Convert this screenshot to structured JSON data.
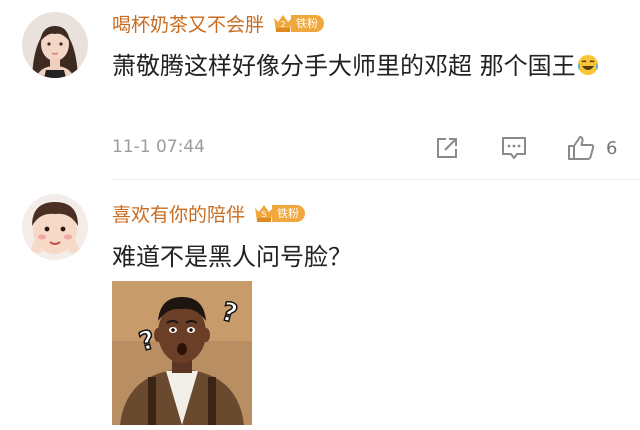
{
  "comments": [
    {
      "username": "喝杯奶茶又不会胖",
      "fan_badge": {
        "level": "2",
        "label": "铁粉"
      },
      "text": "萧敬腾这样好像分手大师里的邓超 那个国王",
      "emoji": "laugh-cry-emoji",
      "timestamp": "11-1 07:44",
      "likes": "6",
      "icons": [
        "share-icon",
        "comment-icon",
        "like-icon"
      ]
    },
    {
      "username": "喜欢有你的陪伴",
      "fan_badge": {
        "level": "5",
        "label": "铁粉"
      },
      "text": "难道不是黑人问号脸？",
      "image": "black-man-question-mark-meme",
      "image_text": [
        "?",
        "?"
      ]
    }
  ],
  "colors": {
    "username": "#c96c21",
    "badge": "#f0a73c",
    "meta": "#9b9b9b",
    "text": "#222222"
  }
}
